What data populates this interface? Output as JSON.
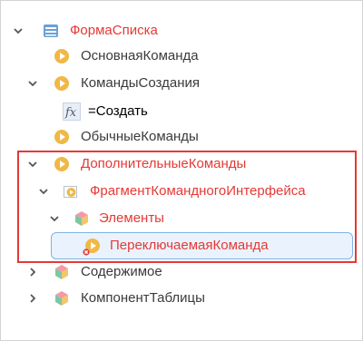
{
  "tree": {
    "root": {
      "label": "ФормаСписка",
      "icon": "form-list-icon"
    },
    "main_command": {
      "label": "ОсновнаяКоманда",
      "icon": "command-play-icon"
    },
    "create_commands": {
      "label": "КомандыСоздания",
      "icon": "command-play-icon"
    },
    "create_formula": {
      "label": "=Создать",
      "icon": "function-fx-icon"
    },
    "regular_commands": {
      "label": "ОбычныеКоманды",
      "icon": "command-play-icon"
    },
    "additional_commands": {
      "label": "ДополнительныеКоманды",
      "icon": "command-play-icon"
    },
    "fragment": {
      "label": "ФрагментКомандногоИнтерфейса",
      "icon": "command-fragment-icon"
    },
    "elements": {
      "label": "Элементы",
      "icon": "cube-icon"
    },
    "toggle_command": {
      "label": "ПереключаемаяКоманда",
      "icon": "command-play-error-icon"
    },
    "content": {
      "label": "Содержимое",
      "icon": "cube-icon"
    },
    "table_component": {
      "label": "КомпонентТаблицы",
      "icon": "cube-icon"
    }
  },
  "colors": {
    "highlight": "#e53935",
    "selection_border": "#7fb2e5",
    "selection_background": "#eaf3fd",
    "play_icon": "#f0b845",
    "text": "#3a3a3a"
  }
}
